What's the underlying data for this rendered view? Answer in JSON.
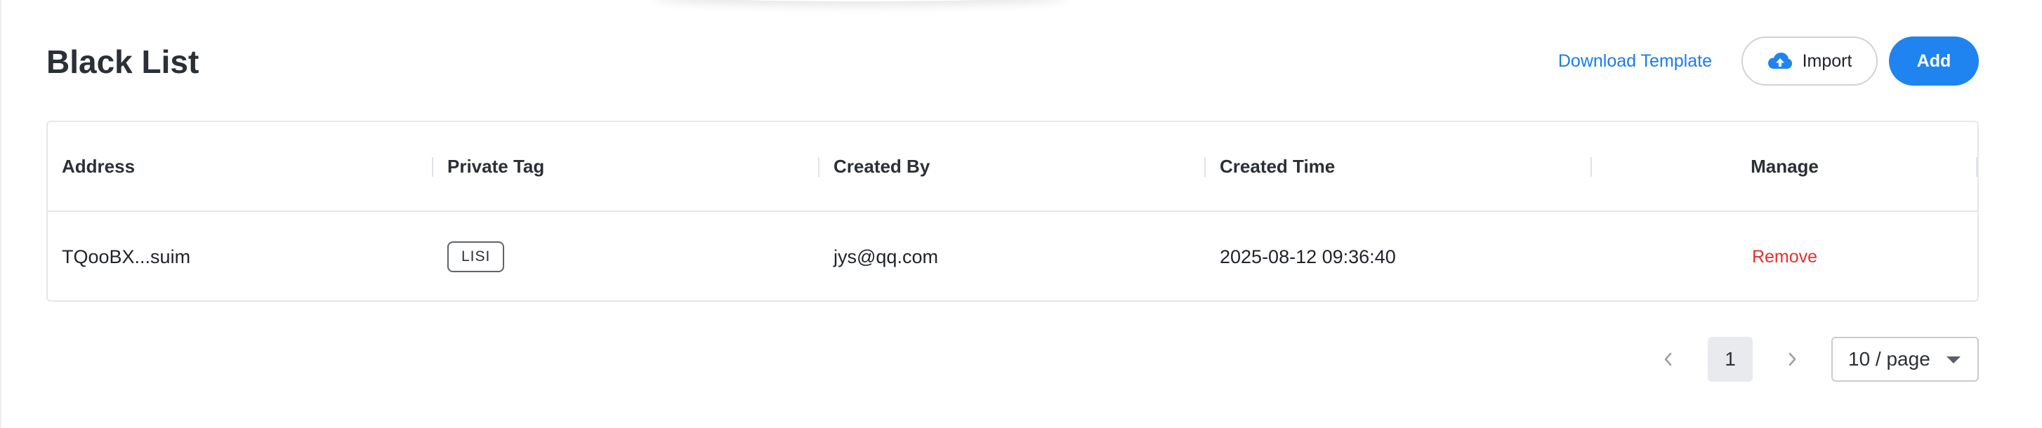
{
  "header": {
    "title": "Black List",
    "download_template_label": "Download Template",
    "import_label": "Import",
    "import_icon": "cloud-upload-icon",
    "add_label": "Add"
  },
  "table": {
    "columns": [
      "Address",
      "Private Tag",
      "Created By",
      "Created Time",
      "Manage"
    ],
    "rows": [
      {
        "address": "TQooBX...suim",
        "private_tag": "LISI",
        "created_by": "jys@qq.com",
        "created_time": "2025-08-12 09:36:40",
        "manage_action": "Remove"
      }
    ]
  },
  "pagination": {
    "current_page": "1",
    "page_size_label": "10 / page",
    "prev_icon": "chevron-left-icon",
    "next_icon": "chevron-right-icon"
  },
  "colors": {
    "accent": "#1f84f0",
    "link": "#1a7bf0",
    "danger": "#e5302b"
  }
}
